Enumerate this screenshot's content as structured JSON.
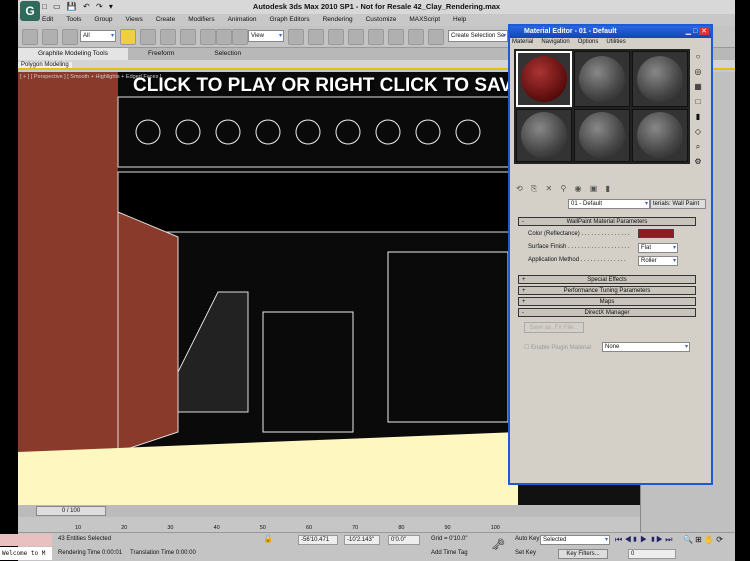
{
  "app": {
    "title": "Autodesk 3ds Max  2010 SP1   - Not for Resale    42_Clay_Rendering.max",
    "logo": "G"
  },
  "menu": [
    "Edit",
    "Tools",
    "Group",
    "Views",
    "Create",
    "Modifiers",
    "Animation",
    "Graph Editors",
    "Rendering",
    "Customize",
    "MAXScript",
    "Help"
  ],
  "toolbar": {
    "filter": "All",
    "ref_coord": "View",
    "selection_set": "Create Selection Se"
  },
  "ribbon": {
    "tabs": [
      "Graphite Modeling Tools",
      "Freeform",
      "Selection"
    ],
    "panel": "Polygon Modeling"
  },
  "viewport": {
    "label": "[ + ] [ Perspective ] [ Smooth + Highlights + Edged Faces ]",
    "overlay": "CLICK TO PLAY OR RIGHT CLICK TO SAVE! :)"
  },
  "material_editor": {
    "title": "Material Editor - 01 - Default",
    "menu": [
      "Material",
      "Navigation",
      "Options",
      "Utilities"
    ],
    "material_name": "01 - Default",
    "type_button": "terials: Wall Paint",
    "rollout_main": "WallPaint Material Parameters",
    "color_label": "Color (Reflectance) . . . . . . . . . . . . . . .",
    "color_value": "#8b1e1e",
    "finish_label": "Surface Finish . . . . . . . . . . . . . . . . . . .",
    "finish_value": "Flat",
    "method_label": "Application Method . . . . . . . . . . . . . .",
    "method_value": "Roller",
    "rollouts": [
      "Special Effects",
      "Performance Tuning Parameters",
      "Maps",
      "DirectX Manager"
    ],
    "save_fx": "Save as .FX File...",
    "plugin_label": "Enable Plugin Material",
    "plugin_value": "None"
  },
  "timeline": {
    "frame": "0 / 100",
    "ticks": [
      "10",
      "20",
      "30",
      "40",
      "50",
      "60",
      "70",
      "80",
      "90",
      "100"
    ]
  },
  "status": {
    "selected": "43 Entities Selected",
    "render_time": "Rendering Time  0:00:01",
    "translation_time": "Translation Time  0:00:00",
    "x": "-56'10.471",
    "y": "-10'2.143\"",
    "z": "0'0.0\"",
    "grid": "Grid = 0'10.0\"",
    "add_time_tag": "Add Time Tag",
    "auto_key": "Auto Key",
    "set_key": "Set Key",
    "key_mode": "Selected",
    "key_filters": "Key Filters...",
    "current_frame": "0",
    "listener": "Welcome to M"
  }
}
